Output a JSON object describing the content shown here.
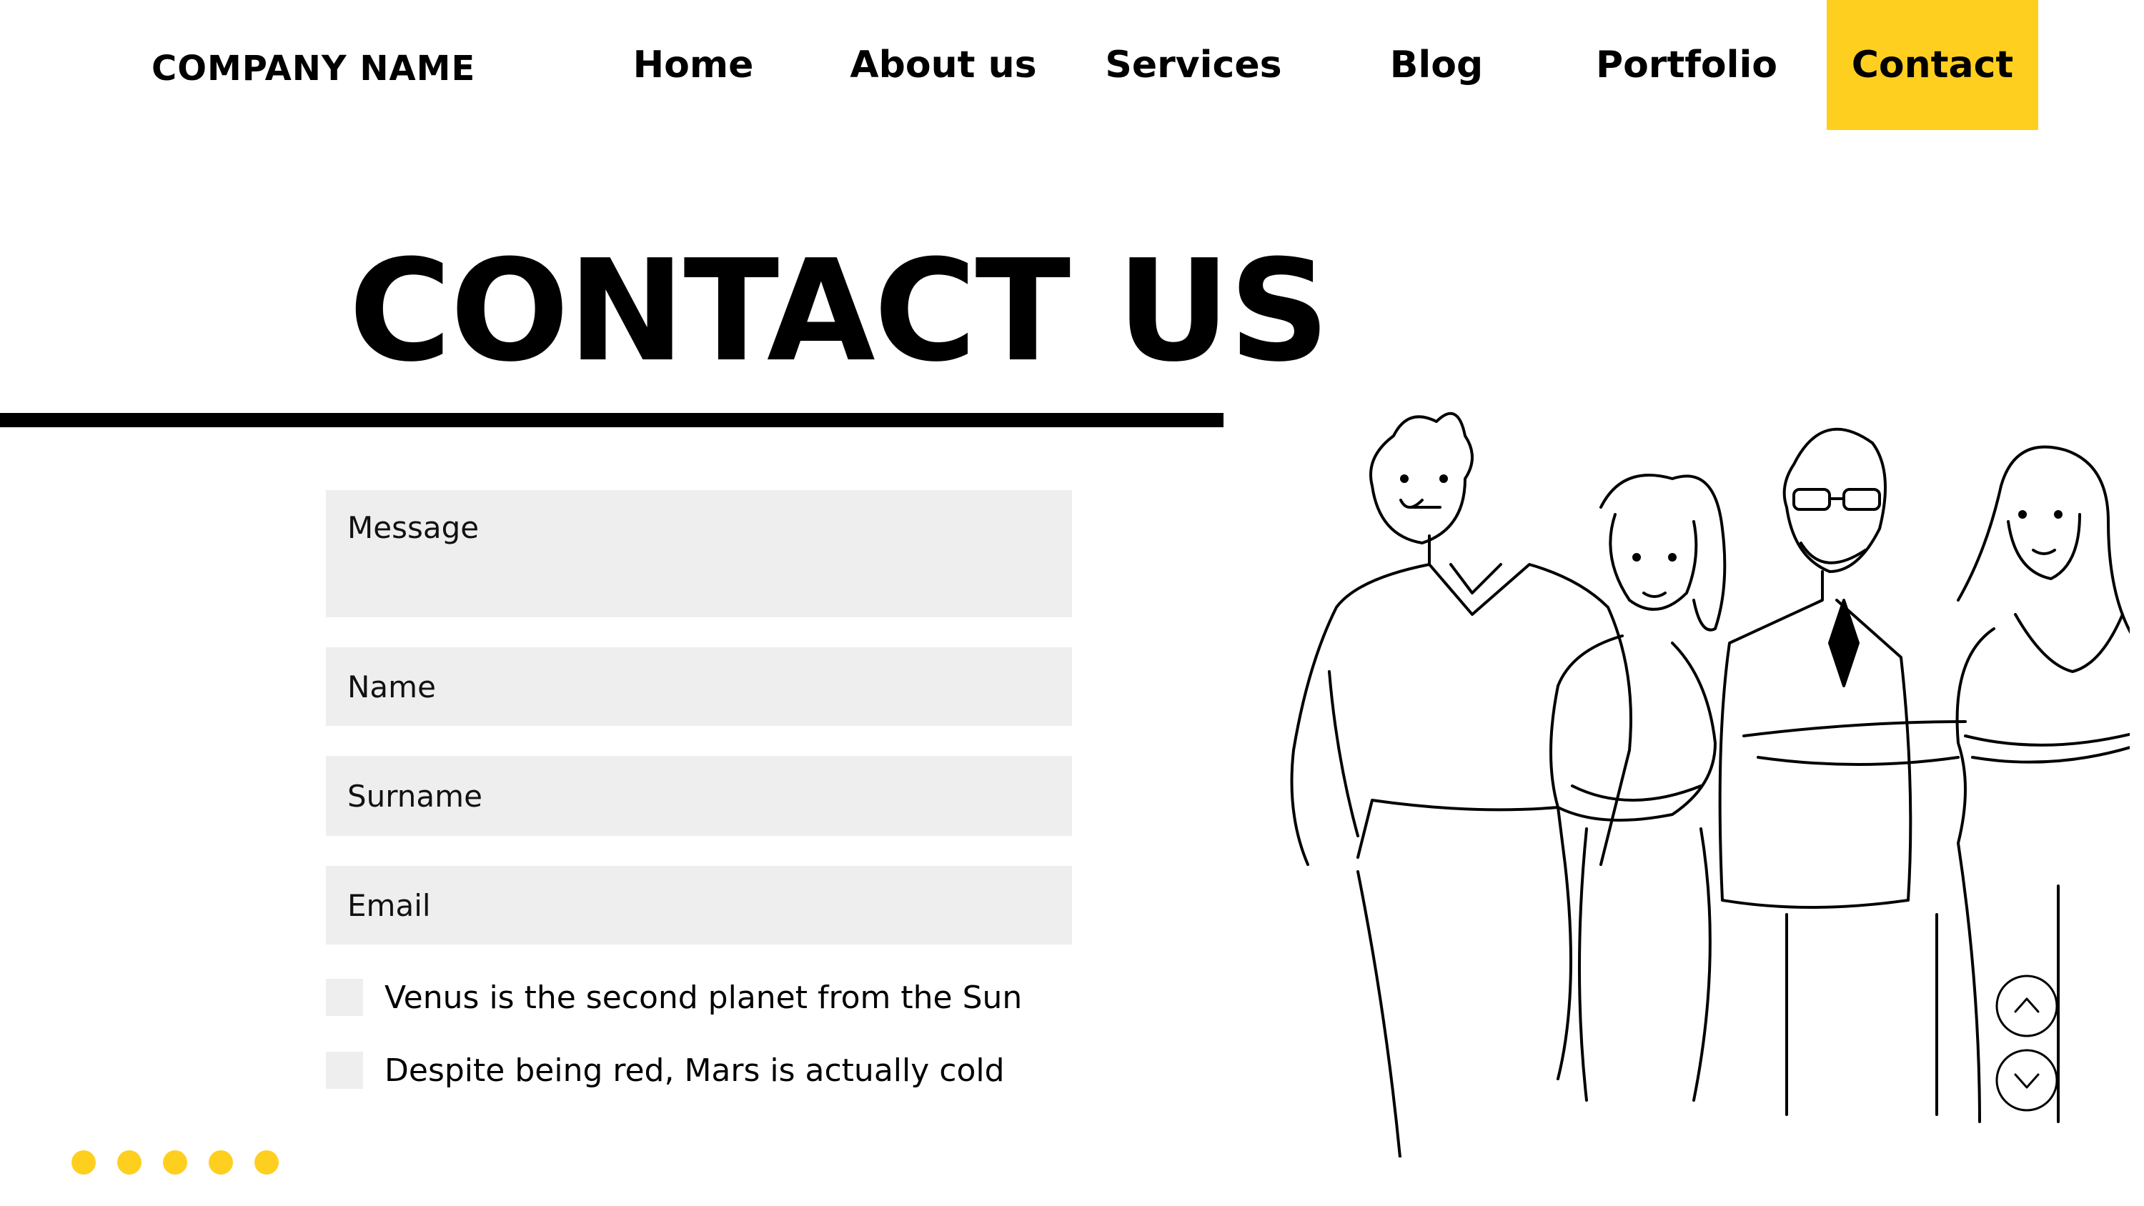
{
  "header": {
    "company_name": "COMPANY NAME",
    "nav": [
      {
        "label": "Home"
      },
      {
        "label": "About us"
      },
      {
        "label": "Services"
      },
      {
        "label": "Blog"
      },
      {
        "label": "Portfolio"
      },
      {
        "label": "Contact",
        "active": true
      }
    ]
  },
  "page": {
    "title": "CONTACT US"
  },
  "form": {
    "message_placeholder": "Message",
    "name_placeholder": "Name",
    "surname_placeholder": "Surname",
    "email_placeholder": "Email",
    "options": [
      {
        "label": "Venus is the second planet from the Sun"
      },
      {
        "label": "Despite being red, Mars is actually cold"
      }
    ]
  },
  "illustration": {
    "subject": "team-of-four-people-line-drawing"
  },
  "scroll": {
    "up_icon": "chevron-up-icon",
    "down_icon": "chevron-down-icon"
  },
  "pagination": {
    "dots": 5
  },
  "colors": {
    "accent": "#FFCF20",
    "field_bg": "#EEEEEE",
    "text": "#000000"
  }
}
